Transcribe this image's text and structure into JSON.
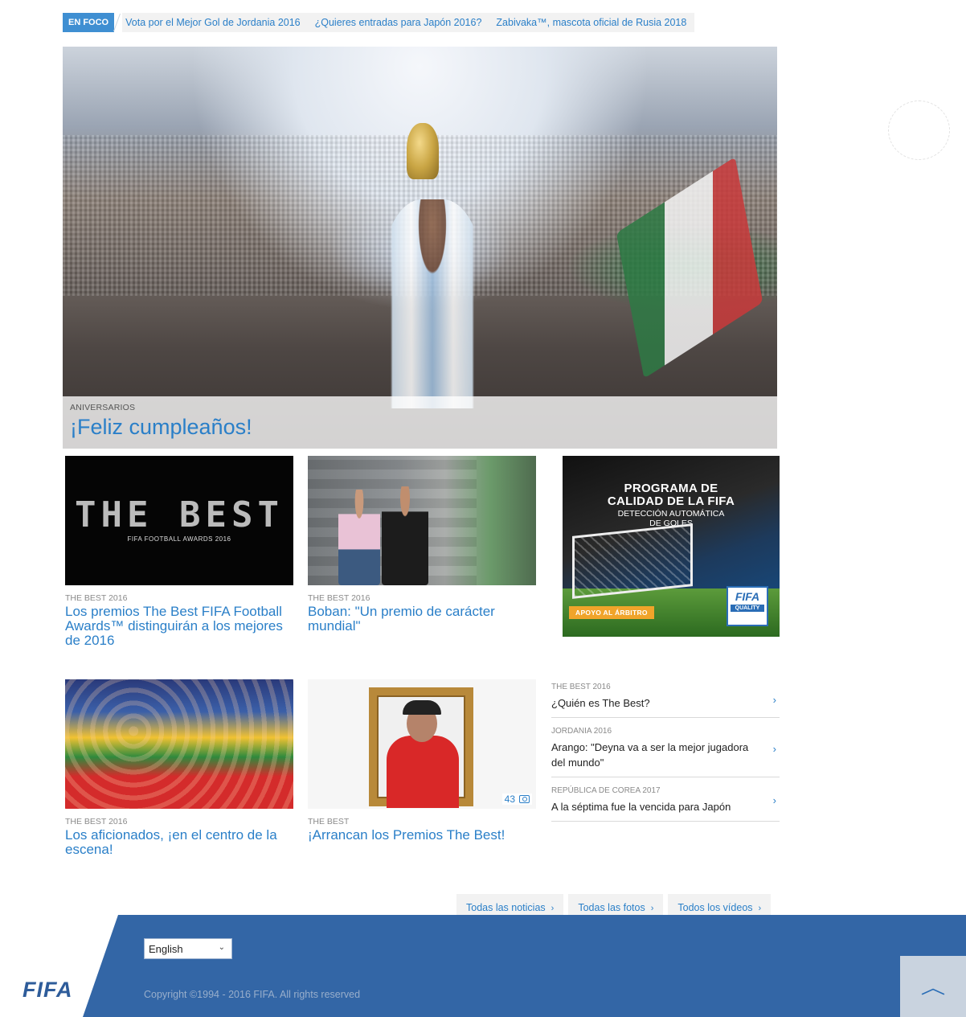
{
  "en_foco": {
    "badge": "EN FOCO",
    "links": [
      "Vota por el Mejor Gol de Jordania 2016",
      "¿Quieres entradas para Japón 2016?",
      "Zabivaka™, mascota oficial de Rusia 2018"
    ]
  },
  "hero": {
    "category": "ANIVERSARIOS",
    "title": "¡Feliz cumpleaños!"
  },
  "cards": [
    {
      "category": "THE BEST 2016",
      "title": "Los premios The Best FIFA Football Awards™ distinguirán a los mejores de 2016",
      "image_text": "THE BEST",
      "image_subtext": "FIFA FOOTBALL AWARDS 2016"
    },
    {
      "category": "THE BEST 2016",
      "title": "Boban: \"Un premio de carácter mundial\""
    },
    {
      "category": "THE BEST 2016",
      "title": "Los aficionados, ¡en el centro de la escena!"
    },
    {
      "category": "THE BEST",
      "title": "¡Arrancan los Premios The Best!",
      "photo_count": "43"
    }
  ],
  "ad": {
    "title_line1": "PROGRAMA DE",
    "title_line2": "CALIDAD DE LA FIFA",
    "subtitle_line1": "DETECCIÓN AUTOMÁTICA",
    "subtitle_line2": "DE GOLES",
    "tag": "APOYO AL ÁRBITRO",
    "logo_main": "FIFA",
    "logo_sub": "QUALITY"
  },
  "side_list": [
    {
      "category": "THE BEST 2016",
      "title": "¿Quién es The Best?"
    },
    {
      "category": "JORDANIA 2016",
      "title": "Arango: \"Deyna va a ser la mejor jugadora del mundo\""
    },
    {
      "category": "REPÚBLICA DE COREA 2017",
      "title": "A la séptima fue la vencida para Japón"
    }
  ],
  "link_bar": [
    "Todas las noticias",
    "Todas las fotos",
    "Todos los vídeos"
  ],
  "footer": {
    "logo": "FIFA",
    "language": "English",
    "copyright": "Copyright ©1994 - 2016 FIFA. All rights reserved"
  },
  "icons": {
    "chevron": "›",
    "chevron_down": "⌄",
    "back_to_top": "︿"
  },
  "colors": {
    "accent": "#2a7fc8",
    "footer_bg": "#3366a6",
    "badge_bg": "#3f8fd2"
  }
}
